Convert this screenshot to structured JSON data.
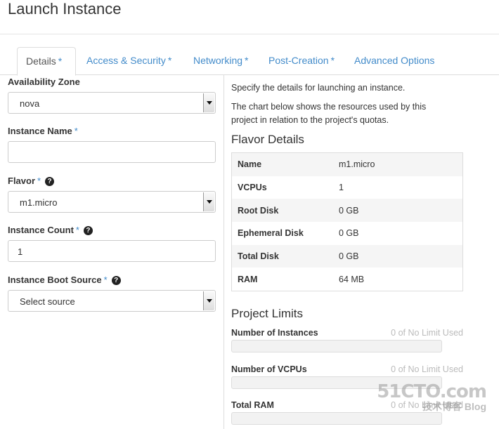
{
  "page": {
    "title": "Launch Instance"
  },
  "tabs": [
    {
      "label": "Details",
      "required": "*"
    },
    {
      "label": "Access & Security",
      "required": "*"
    },
    {
      "label": "Networking",
      "required": "*"
    },
    {
      "label": "Post-Creation",
      "required": "*"
    },
    {
      "label": "Advanced Options",
      "required": ""
    }
  ],
  "form": {
    "availability_zone": {
      "label": "Availability Zone",
      "value": "nova"
    },
    "instance_name": {
      "label": "Instance Name",
      "required": "*",
      "value": ""
    },
    "flavor": {
      "label": "Flavor",
      "required": "*",
      "value": "m1.micro"
    },
    "instance_count": {
      "label": "Instance Count",
      "required": "*",
      "value": "1"
    },
    "boot_source": {
      "label": "Instance Boot Source",
      "required": "*",
      "value": "Select source"
    },
    "help_glyph": "?"
  },
  "details": {
    "intro": "Specify the details for launching an instance.",
    "chart_note": "The chart below shows the resources used by this project in relation to the project's quotas.",
    "flavor_title": "Flavor Details",
    "flavor_rows": [
      {
        "key": "Name",
        "value": "m1.micro"
      },
      {
        "key": "VCPUs",
        "value": "1"
      },
      {
        "key": "Root Disk",
        "value": "0 GB"
      },
      {
        "key": "Ephemeral Disk",
        "value": "0 GB"
      },
      {
        "key": "Total Disk",
        "value": "0 GB"
      },
      {
        "key": "RAM",
        "value": "64 MB"
      }
    ],
    "limits_title": "Project Limits",
    "limits": [
      {
        "label": "Number of Instances",
        "used": "0 of No Limit Used",
        "fraction": 0
      },
      {
        "label": "Number of VCPUs",
        "used": "0 of No Limit Used",
        "fraction": 0
      },
      {
        "label": "Total RAM",
        "used": "0 of No Limit Used",
        "fraction": 0
      }
    ]
  },
  "watermark": {
    "logo": "51CTO.com",
    "sub": "技术博客  Blog"
  },
  "colors": {
    "link": "#428bca",
    "muted": "#bbbbbb"
  }
}
